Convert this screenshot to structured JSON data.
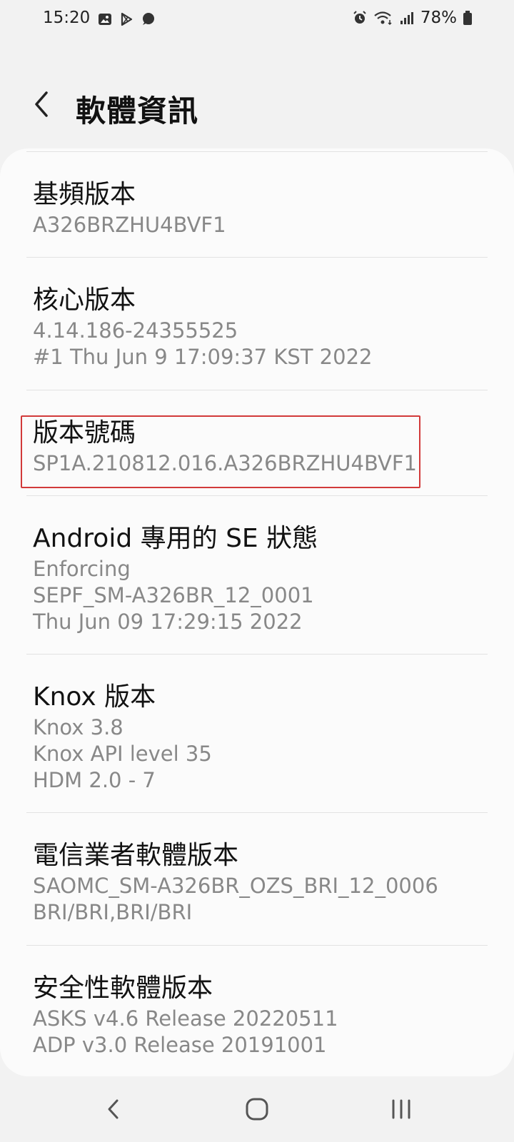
{
  "status_bar": {
    "time": "15:20",
    "battery": "78%",
    "left_icons": [
      "gallery-icon",
      "play-store-icon",
      "chat-icon"
    ],
    "right_icons": [
      "alarm-icon",
      "wifi-icon",
      "signal-icon",
      "battery-icon"
    ]
  },
  "header": {
    "title": "軟體資訊",
    "back_icon": "back-arrow-icon"
  },
  "items": [
    {
      "title": "基頻版本",
      "lines": [
        "A326BRZHU4BVF1"
      ]
    },
    {
      "title": "核心版本",
      "lines": [
        "4.14.186-24355525",
        "#1 Thu Jun 9 17:09:37 KST 2022"
      ]
    },
    {
      "title": "版本號碼",
      "lines": [
        "SP1A.210812.016.A326BRZHU4BVF1"
      ],
      "highlighted": true
    },
    {
      "title": "Android 專用的 SE 狀態",
      "lines": [
        "Enforcing",
        "SEPF_SM-A326BR_12_0001",
        "Thu Jun 09 17:29:15 2022"
      ]
    },
    {
      "title": "Knox 版本",
      "lines": [
        "Knox 3.8",
        "Knox API level 35",
        "HDM 2.0 - 7"
      ]
    },
    {
      "title": "電信業者軟體版本",
      "lines": [
        "SAOMC_SM-A326BR_OZS_BRI_12_0006",
        "BRI/BRI,BRI/BRI"
      ]
    },
    {
      "title": "安全性軟體版本",
      "lines": [
        "ASKS v4.6 Release 20220511",
        "ADP v3.0 Release 20191001"
      ]
    }
  ],
  "nav_bar": {
    "buttons": [
      "back-nav-icon",
      "home-icon",
      "recents-icon"
    ]
  },
  "colors": {
    "background": "#f2f2f2",
    "card": "#fbfbfb",
    "highlight": "#d23a3a",
    "secondary_text": "#888888"
  }
}
